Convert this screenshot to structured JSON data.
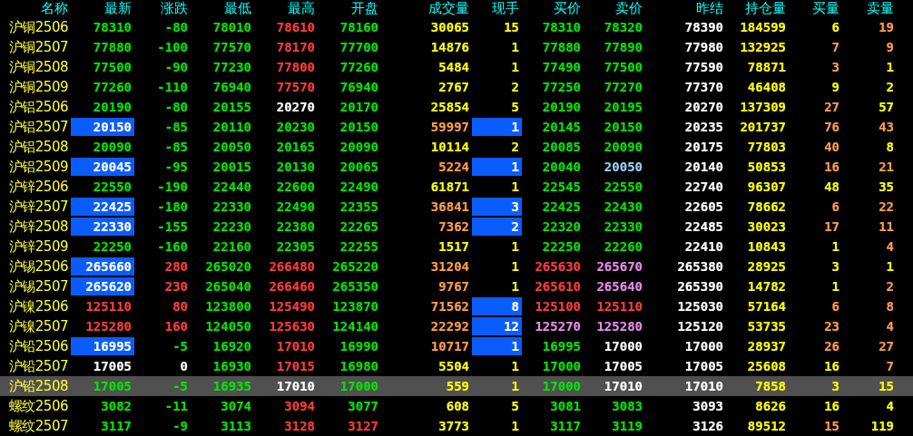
{
  "columns": [
    "名称",
    "最新",
    "涨跌",
    "最低",
    "最高",
    "开盘",
    "成交量",
    "现手",
    "买价",
    "卖价",
    "昨结",
    "持仓量",
    "买量",
    "卖量"
  ],
  "rows": [
    {
      "name": "沪铜2506",
      "selected": false,
      "latest_highlighted": false,
      "tick_highlighted": false,
      "cells": [
        {
          "text": "78310",
          "color": "#00e600"
        },
        {
          "text": "-80",
          "color": "#00e600"
        },
        {
          "text": "78010",
          "color": "#00e600"
        },
        {
          "text": "78610",
          "color": "#ff3c3c"
        },
        {
          "text": "78160",
          "color": "#00e600"
        },
        {
          "text": "30065",
          "color": "#ffff00"
        },
        {
          "text": "15",
          "color": "#ffff00"
        },
        {
          "text": "78310",
          "color": "#00e600"
        },
        {
          "text": "78320",
          "color": "#00e600"
        },
        {
          "text": "78390",
          "color": "#ffffff"
        },
        {
          "text": "184599",
          "color": "#ffff00"
        },
        {
          "text": "6",
          "color": "#ffff00"
        },
        {
          "text": "19",
          "color": "#ff9e4a"
        }
      ]
    },
    {
      "name": "沪铜2507",
      "selected": false,
      "latest_highlighted": false,
      "tick_highlighted": false,
      "cells": [
        {
          "text": "77880",
          "color": "#00e600"
        },
        {
          "text": "-100",
          "color": "#00e600"
        },
        {
          "text": "77570",
          "color": "#00e600"
        },
        {
          "text": "78170",
          "color": "#ff3c3c"
        },
        {
          "text": "77700",
          "color": "#00e600"
        },
        {
          "text": "14876",
          "color": "#ffff00"
        },
        {
          "text": "1",
          "color": "#ffff00"
        },
        {
          "text": "77880",
          "color": "#00e600"
        },
        {
          "text": "77890",
          "color": "#00e600"
        },
        {
          "text": "77980",
          "color": "#ffffff"
        },
        {
          "text": "132925",
          "color": "#ffff00"
        },
        {
          "text": "7",
          "color": "#ff9e4a"
        },
        {
          "text": "9",
          "color": "#ff9e4a"
        }
      ]
    },
    {
      "name": "沪铜2508",
      "selected": false,
      "latest_highlighted": false,
      "tick_highlighted": false,
      "cells": [
        {
          "text": "77500",
          "color": "#00e600"
        },
        {
          "text": "-90",
          "color": "#00e600"
        },
        {
          "text": "77230",
          "color": "#00e600"
        },
        {
          "text": "77800",
          "color": "#ff3c3c"
        },
        {
          "text": "77260",
          "color": "#00e600"
        },
        {
          "text": "5484",
          "color": "#ffff00"
        },
        {
          "text": "1",
          "color": "#ffff00"
        },
        {
          "text": "77490",
          "color": "#00e600"
        },
        {
          "text": "77500",
          "color": "#00e600"
        },
        {
          "text": "77590",
          "color": "#ffffff"
        },
        {
          "text": "78871",
          "color": "#ffff00"
        },
        {
          "text": "3",
          "color": "#ff9e4a"
        },
        {
          "text": "1",
          "color": "#ffff00"
        }
      ]
    },
    {
      "name": "沪铜2509",
      "selected": false,
      "latest_highlighted": false,
      "tick_highlighted": false,
      "cells": [
        {
          "text": "77260",
          "color": "#00e600"
        },
        {
          "text": "-110",
          "color": "#00e600"
        },
        {
          "text": "76940",
          "color": "#00e600"
        },
        {
          "text": "77570",
          "color": "#ff3c3c"
        },
        {
          "text": "76940",
          "color": "#00e600"
        },
        {
          "text": "2767",
          "color": "#ffff00"
        },
        {
          "text": "2",
          "color": "#ffff00"
        },
        {
          "text": "77250",
          "color": "#00e600"
        },
        {
          "text": "77270",
          "color": "#00e600"
        },
        {
          "text": "77370",
          "color": "#ffffff"
        },
        {
          "text": "46408",
          "color": "#ffff00"
        },
        {
          "text": "9",
          "color": "#ffff00"
        },
        {
          "text": "2",
          "color": "#ffff00"
        }
      ]
    },
    {
      "name": "沪铝2506",
      "selected": false,
      "latest_highlighted": false,
      "tick_highlighted": false,
      "cells": [
        {
          "text": "20190",
          "color": "#00e600"
        },
        {
          "text": "-80",
          "color": "#00e600"
        },
        {
          "text": "20155",
          "color": "#00e600"
        },
        {
          "text": "20270",
          "color": "#ffffff"
        },
        {
          "text": "20170",
          "color": "#00e600"
        },
        {
          "text": "25854",
          "color": "#ffff00"
        },
        {
          "text": "5",
          "color": "#ffff00"
        },
        {
          "text": "20190",
          "color": "#00e600"
        },
        {
          "text": "20195",
          "color": "#00e600"
        },
        {
          "text": "20270",
          "color": "#ffffff"
        },
        {
          "text": "137309",
          "color": "#ffff00"
        },
        {
          "text": "27",
          "color": "#ff9e4a"
        },
        {
          "text": "57",
          "color": "#ffff00"
        }
      ]
    },
    {
      "name": "沪铝2507",
      "selected": false,
      "latest_highlighted": true,
      "tick_highlighted": true,
      "cells": [
        {
          "text": "20150",
          "color": "#ffffff"
        },
        {
          "text": "-85",
          "color": "#00e600"
        },
        {
          "text": "20110",
          "color": "#00e600"
        },
        {
          "text": "20230",
          "color": "#00e600"
        },
        {
          "text": "20150",
          "color": "#00e600"
        },
        {
          "text": "59997",
          "color": "#ff9e4a"
        },
        {
          "text": "1",
          "color": "#ffffff"
        },
        {
          "text": "20145",
          "color": "#00e600"
        },
        {
          "text": "20150",
          "color": "#00e600"
        },
        {
          "text": "20235",
          "color": "#ffffff"
        },
        {
          "text": "201737",
          "color": "#ffff00"
        },
        {
          "text": "76",
          "color": "#ff9e4a"
        },
        {
          "text": "43",
          "color": "#ff9e4a"
        }
      ]
    },
    {
      "name": "沪铝2508",
      "selected": false,
      "latest_highlighted": false,
      "tick_highlighted": false,
      "cells": [
        {
          "text": "20090",
          "color": "#00e600"
        },
        {
          "text": "-85",
          "color": "#00e600"
        },
        {
          "text": "20050",
          "color": "#00e600"
        },
        {
          "text": "20165",
          "color": "#00e600"
        },
        {
          "text": "20090",
          "color": "#00e600"
        },
        {
          "text": "10114",
          "color": "#ffff00"
        },
        {
          "text": "2",
          "color": "#ffff00"
        },
        {
          "text": "20085",
          "color": "#00e600"
        },
        {
          "text": "20090",
          "color": "#00e600"
        },
        {
          "text": "20175",
          "color": "#ffffff"
        },
        {
          "text": "77803",
          "color": "#ffff00"
        },
        {
          "text": "40",
          "color": "#ff9e4a"
        },
        {
          "text": "8",
          "color": "#ffff00"
        }
      ]
    },
    {
      "name": "沪铝2509",
      "selected": false,
      "latest_highlighted": true,
      "tick_highlighted": true,
      "cells": [
        {
          "text": "20045",
          "color": "#ffffff"
        },
        {
          "text": "-95",
          "color": "#00e600"
        },
        {
          "text": "20015",
          "color": "#00e600"
        },
        {
          "text": "20130",
          "color": "#00e600"
        },
        {
          "text": "20065",
          "color": "#00e600"
        },
        {
          "text": "5224",
          "color": "#ff9e4a"
        },
        {
          "text": "1",
          "color": "#ffffff"
        },
        {
          "text": "20040",
          "color": "#00e600"
        },
        {
          "text": "20050",
          "color": "#99ccff"
        },
        {
          "text": "20140",
          "color": "#ffffff"
        },
        {
          "text": "50853",
          "color": "#ffff00"
        },
        {
          "text": "16",
          "color": "#ff9e4a"
        },
        {
          "text": "21",
          "color": "#ff9e4a"
        }
      ]
    },
    {
      "name": "沪锌2506",
      "selected": false,
      "latest_highlighted": false,
      "tick_highlighted": false,
      "cells": [
        {
          "text": "22550",
          "color": "#00e600"
        },
        {
          "text": "-190",
          "color": "#00e600"
        },
        {
          "text": "22440",
          "color": "#00e600"
        },
        {
          "text": "22600",
          "color": "#00e600"
        },
        {
          "text": "22490",
          "color": "#00e600"
        },
        {
          "text": "61871",
          "color": "#ffff00"
        },
        {
          "text": "1",
          "color": "#ffff00"
        },
        {
          "text": "22545",
          "color": "#00e600"
        },
        {
          "text": "22550",
          "color": "#00e600"
        },
        {
          "text": "22740",
          "color": "#ffffff"
        },
        {
          "text": "96307",
          "color": "#ffff00"
        },
        {
          "text": "48",
          "color": "#ffff00"
        },
        {
          "text": "35",
          "color": "#ffff00"
        }
      ]
    },
    {
      "name": "沪锌2507",
      "selected": false,
      "latest_highlighted": true,
      "tick_highlighted": true,
      "cells": [
        {
          "text": "22425",
          "color": "#ffffff"
        },
        {
          "text": "-180",
          "color": "#00e600"
        },
        {
          "text": "22330",
          "color": "#00e600"
        },
        {
          "text": "22490",
          "color": "#00e600"
        },
        {
          "text": "22355",
          "color": "#00e600"
        },
        {
          "text": "36841",
          "color": "#ff9e4a"
        },
        {
          "text": "3",
          "color": "#ffffff"
        },
        {
          "text": "22425",
          "color": "#00e600"
        },
        {
          "text": "22430",
          "color": "#00e600"
        },
        {
          "text": "22605",
          "color": "#ffffff"
        },
        {
          "text": "78662",
          "color": "#ffff00"
        },
        {
          "text": "6",
          "color": "#ff9e4a"
        },
        {
          "text": "22",
          "color": "#ff9e4a"
        }
      ]
    },
    {
      "name": "沪锌2508",
      "selected": false,
      "latest_highlighted": true,
      "tick_highlighted": true,
      "cells": [
        {
          "text": "22330",
          "color": "#ffffff"
        },
        {
          "text": "-155",
          "color": "#00e600"
        },
        {
          "text": "22230",
          "color": "#00e600"
        },
        {
          "text": "22380",
          "color": "#00e600"
        },
        {
          "text": "22265",
          "color": "#00e600"
        },
        {
          "text": "7362",
          "color": "#ff9e4a"
        },
        {
          "text": "2",
          "color": "#ffffff"
        },
        {
          "text": "22320",
          "color": "#00e600"
        },
        {
          "text": "22330",
          "color": "#00e600"
        },
        {
          "text": "22485",
          "color": "#ffffff"
        },
        {
          "text": "30023",
          "color": "#ffff00"
        },
        {
          "text": "17",
          "color": "#ff9e4a"
        },
        {
          "text": "11",
          "color": "#ff9e4a"
        }
      ]
    },
    {
      "name": "沪锌2509",
      "selected": false,
      "latest_highlighted": false,
      "tick_highlighted": false,
      "cells": [
        {
          "text": "22250",
          "color": "#00e600"
        },
        {
          "text": "-160",
          "color": "#00e600"
        },
        {
          "text": "22160",
          "color": "#00e600"
        },
        {
          "text": "22305",
          "color": "#00e600"
        },
        {
          "text": "22255",
          "color": "#00e600"
        },
        {
          "text": "1517",
          "color": "#ffff00"
        },
        {
          "text": "1",
          "color": "#ffff00"
        },
        {
          "text": "22250",
          "color": "#00e600"
        },
        {
          "text": "22260",
          "color": "#00e600"
        },
        {
          "text": "22410",
          "color": "#ffffff"
        },
        {
          "text": "10843",
          "color": "#ffff00"
        },
        {
          "text": "1",
          "color": "#ffff00"
        },
        {
          "text": "4",
          "color": "#ff9e4a"
        }
      ]
    },
    {
      "name": "沪锡2506",
      "selected": false,
      "latest_highlighted": true,
      "tick_highlighted": false,
      "cells": [
        {
          "text": "265660",
          "color": "#ffffff"
        },
        {
          "text": "280",
          "color": "#ff3c3c"
        },
        {
          "text": "265020",
          "color": "#00e600"
        },
        {
          "text": "266480",
          "color": "#ff3c3c"
        },
        {
          "text": "265220",
          "color": "#00e600"
        },
        {
          "text": "31204",
          "color": "#ff9e4a"
        },
        {
          "text": "1",
          "color": "#ffff00"
        },
        {
          "text": "265630",
          "color": "#ff3c3c"
        },
        {
          "text": "265670",
          "color": "#e88ae8"
        },
        {
          "text": "265380",
          "color": "#ffffff"
        },
        {
          "text": "28925",
          "color": "#ffff00"
        },
        {
          "text": "3",
          "color": "#ffff00"
        },
        {
          "text": "1",
          "color": "#ffff00"
        }
      ]
    },
    {
      "name": "沪锡2507",
      "selected": false,
      "latest_highlighted": true,
      "tick_highlighted": false,
      "cells": [
        {
          "text": "265620",
          "color": "#ffffff"
        },
        {
          "text": "230",
          "color": "#ff3c3c"
        },
        {
          "text": "265040",
          "color": "#00e600"
        },
        {
          "text": "266460",
          "color": "#ff3c3c"
        },
        {
          "text": "265350",
          "color": "#00e600"
        },
        {
          "text": "9767",
          "color": "#ff9e4a"
        },
        {
          "text": "1",
          "color": "#ffff00"
        },
        {
          "text": "265610",
          "color": "#ff3c3c"
        },
        {
          "text": "265640",
          "color": "#e88ae8"
        },
        {
          "text": "265390",
          "color": "#ffffff"
        },
        {
          "text": "14782",
          "color": "#ffff00"
        },
        {
          "text": "1",
          "color": "#ffff00"
        },
        {
          "text": "2",
          "color": "#ff9e4a"
        }
      ]
    },
    {
      "name": "沪镍2506",
      "selected": false,
      "latest_highlighted": false,
      "tick_highlighted": true,
      "cells": [
        {
          "text": "125110",
          "color": "#ff3c3c"
        },
        {
          "text": "80",
          "color": "#ff3c3c"
        },
        {
          "text": "123800",
          "color": "#00e600"
        },
        {
          "text": "125490",
          "color": "#ff3c3c"
        },
        {
          "text": "123870",
          "color": "#00e600"
        },
        {
          "text": "71562",
          "color": "#ff9e4a"
        },
        {
          "text": "8",
          "color": "#ffffff"
        },
        {
          "text": "125100",
          "color": "#ff3c3c"
        },
        {
          "text": "125110",
          "color": "#ff3c3c"
        },
        {
          "text": "125030",
          "color": "#ffffff"
        },
        {
          "text": "57164",
          "color": "#ffff00"
        },
        {
          "text": "6",
          "color": "#ff9e4a"
        },
        {
          "text": "8",
          "color": "#ff9e4a"
        }
      ]
    },
    {
      "name": "沪镍2507",
      "selected": false,
      "latest_highlighted": false,
      "tick_highlighted": true,
      "cells": [
        {
          "text": "125280",
          "color": "#ff3c3c"
        },
        {
          "text": "160",
          "color": "#ff3c3c"
        },
        {
          "text": "124050",
          "color": "#00e600"
        },
        {
          "text": "125630",
          "color": "#ff3c3c"
        },
        {
          "text": "124140",
          "color": "#00e600"
        },
        {
          "text": "22292",
          "color": "#ff9e4a"
        },
        {
          "text": "12",
          "color": "#ffffff"
        },
        {
          "text": "125270",
          "color": "#e88ae8"
        },
        {
          "text": "125280",
          "color": "#e88ae8"
        },
        {
          "text": "125120",
          "color": "#ffffff"
        },
        {
          "text": "53735",
          "color": "#ffff00"
        },
        {
          "text": "23",
          "color": "#ff9e4a"
        },
        {
          "text": "4",
          "color": "#ff9e4a"
        }
      ]
    },
    {
      "name": "沪铅2506",
      "selected": false,
      "latest_highlighted": true,
      "tick_highlighted": true,
      "cells": [
        {
          "text": "16995",
          "color": "#ffffff"
        },
        {
          "text": "-5",
          "color": "#00e600"
        },
        {
          "text": "16920",
          "color": "#00e600"
        },
        {
          "text": "17010",
          "color": "#ff3c3c"
        },
        {
          "text": "16990",
          "color": "#00e600"
        },
        {
          "text": "10717",
          "color": "#ff9e4a"
        },
        {
          "text": "1",
          "color": "#ffffff"
        },
        {
          "text": "16995",
          "color": "#00e600"
        },
        {
          "text": "17000",
          "color": "#ffffff"
        },
        {
          "text": "17000",
          "color": "#ffffff"
        },
        {
          "text": "28937",
          "color": "#ffff00"
        },
        {
          "text": "26",
          "color": "#ff9e4a"
        },
        {
          "text": "27",
          "color": "#ff9e4a"
        }
      ]
    },
    {
      "name": "沪铅2507",
      "selected": false,
      "latest_highlighted": false,
      "tick_highlighted": false,
      "cells": [
        {
          "text": "17005",
          "color": "#ffffff"
        },
        {
          "text": "0",
          "color": "#ffffff"
        },
        {
          "text": "16930",
          "color": "#00e600"
        },
        {
          "text": "17015",
          "color": "#ff3c3c"
        },
        {
          "text": "16980",
          "color": "#00e600"
        },
        {
          "text": "5504",
          "color": "#ffff00"
        },
        {
          "text": "1",
          "color": "#ffff00"
        },
        {
          "text": "17000",
          "color": "#00e600"
        },
        {
          "text": "17005",
          "color": "#ffffff"
        },
        {
          "text": "17005",
          "color": "#ffffff"
        },
        {
          "text": "25608",
          "color": "#ffff00"
        },
        {
          "text": "16",
          "color": "#ffff00"
        },
        {
          "text": "7",
          "color": "#ff9e4a"
        }
      ]
    },
    {
      "name": "沪铅2508",
      "selected": true,
      "latest_highlighted": false,
      "tick_highlighted": false,
      "cells": [
        {
          "text": "17005",
          "color": "#00e600"
        },
        {
          "text": "-5",
          "color": "#00e600"
        },
        {
          "text": "16935",
          "color": "#00e600"
        },
        {
          "text": "17010",
          "color": "#ffffff"
        },
        {
          "text": "17000",
          "color": "#00e600"
        },
        {
          "text": "559",
          "color": "#ffff00"
        },
        {
          "text": "1",
          "color": "#ffff00"
        },
        {
          "text": "17000",
          "color": "#00e600"
        },
        {
          "text": "17010",
          "color": "#ffffff"
        },
        {
          "text": "17010",
          "color": "#ffffff"
        },
        {
          "text": "7858",
          "color": "#ffff00"
        },
        {
          "text": "3",
          "color": "#ffff00"
        },
        {
          "text": "15",
          "color": "#ffff00"
        }
      ]
    },
    {
      "name": "螺纹2506",
      "selected": false,
      "latest_highlighted": false,
      "tick_highlighted": false,
      "cells": [
        {
          "text": "3082",
          "color": "#00e600"
        },
        {
          "text": "-11",
          "color": "#00e600"
        },
        {
          "text": "3074",
          "color": "#00e600"
        },
        {
          "text": "3094",
          "color": "#ff3c3c"
        },
        {
          "text": "3077",
          "color": "#00e600"
        },
        {
          "text": "608",
          "color": "#ffff00"
        },
        {
          "text": "5",
          "color": "#ffff00"
        },
        {
          "text": "3081",
          "color": "#00e600"
        },
        {
          "text": "3083",
          "color": "#00e600"
        },
        {
          "text": "3093",
          "color": "#ffffff"
        },
        {
          "text": "8626",
          "color": "#ffff00"
        },
        {
          "text": "16",
          "color": "#ffff00"
        },
        {
          "text": "4",
          "color": "#ffff00"
        }
      ]
    },
    {
      "name": "螺纹2507",
      "selected": false,
      "latest_highlighted": false,
      "tick_highlighted": false,
      "cells": [
        {
          "text": "3117",
          "color": "#00e600"
        },
        {
          "text": "-9",
          "color": "#00e600"
        },
        {
          "text": "3113",
          "color": "#00e600"
        },
        {
          "text": "3128",
          "color": "#ff3c3c"
        },
        {
          "text": "3127",
          "color": "#ff3c3c"
        },
        {
          "text": "3773",
          "color": "#ffff00"
        },
        {
          "text": "1",
          "color": "#ffff00"
        },
        {
          "text": "3117",
          "color": "#00e600"
        },
        {
          "text": "3119",
          "color": "#00e600"
        },
        {
          "text": "3126",
          "color": "#ffffff"
        },
        {
          "text": "89512",
          "color": "#ffff00"
        },
        {
          "text": "15",
          "color": "#ff9e4a"
        },
        {
          "text": "119",
          "color": "#ffff00"
        }
      ]
    }
  ]
}
